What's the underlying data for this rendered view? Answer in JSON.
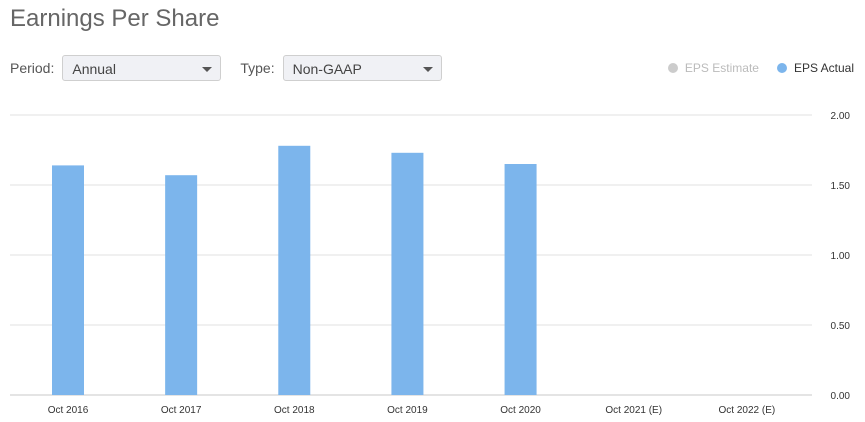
{
  "header": {
    "title": "Earnings Per Share"
  },
  "controls": {
    "period_label": "Period:",
    "period_value": "Annual",
    "type_label": "Type:",
    "type_value": "Non-GAAP"
  },
  "legend": {
    "estimate_label": "EPS Estimate",
    "actual_label": "EPS Actual"
  },
  "colors": {
    "actual": "#7cb5ec",
    "estimate": "#cccccc",
    "grid": "#e0e0e0"
  },
  "chart_data": {
    "type": "bar",
    "categories": [
      "Oct 2016",
      "Oct 2017",
      "Oct 2018",
      "Oct 2019",
      "Oct 2020",
      "Oct 2021 (E)",
      "Oct 2022 (E)"
    ],
    "series": [
      {
        "name": "EPS Actual",
        "values": [
          1.64,
          1.57,
          1.78,
          1.73,
          1.65,
          null,
          null
        ]
      }
    ],
    "ylim": [
      0,
      2
    ],
    "yticks": [
      "0.00",
      "0.50",
      "1.00",
      "1.50",
      "2.00"
    ],
    "yaxis_side": "right",
    "grid": true
  }
}
